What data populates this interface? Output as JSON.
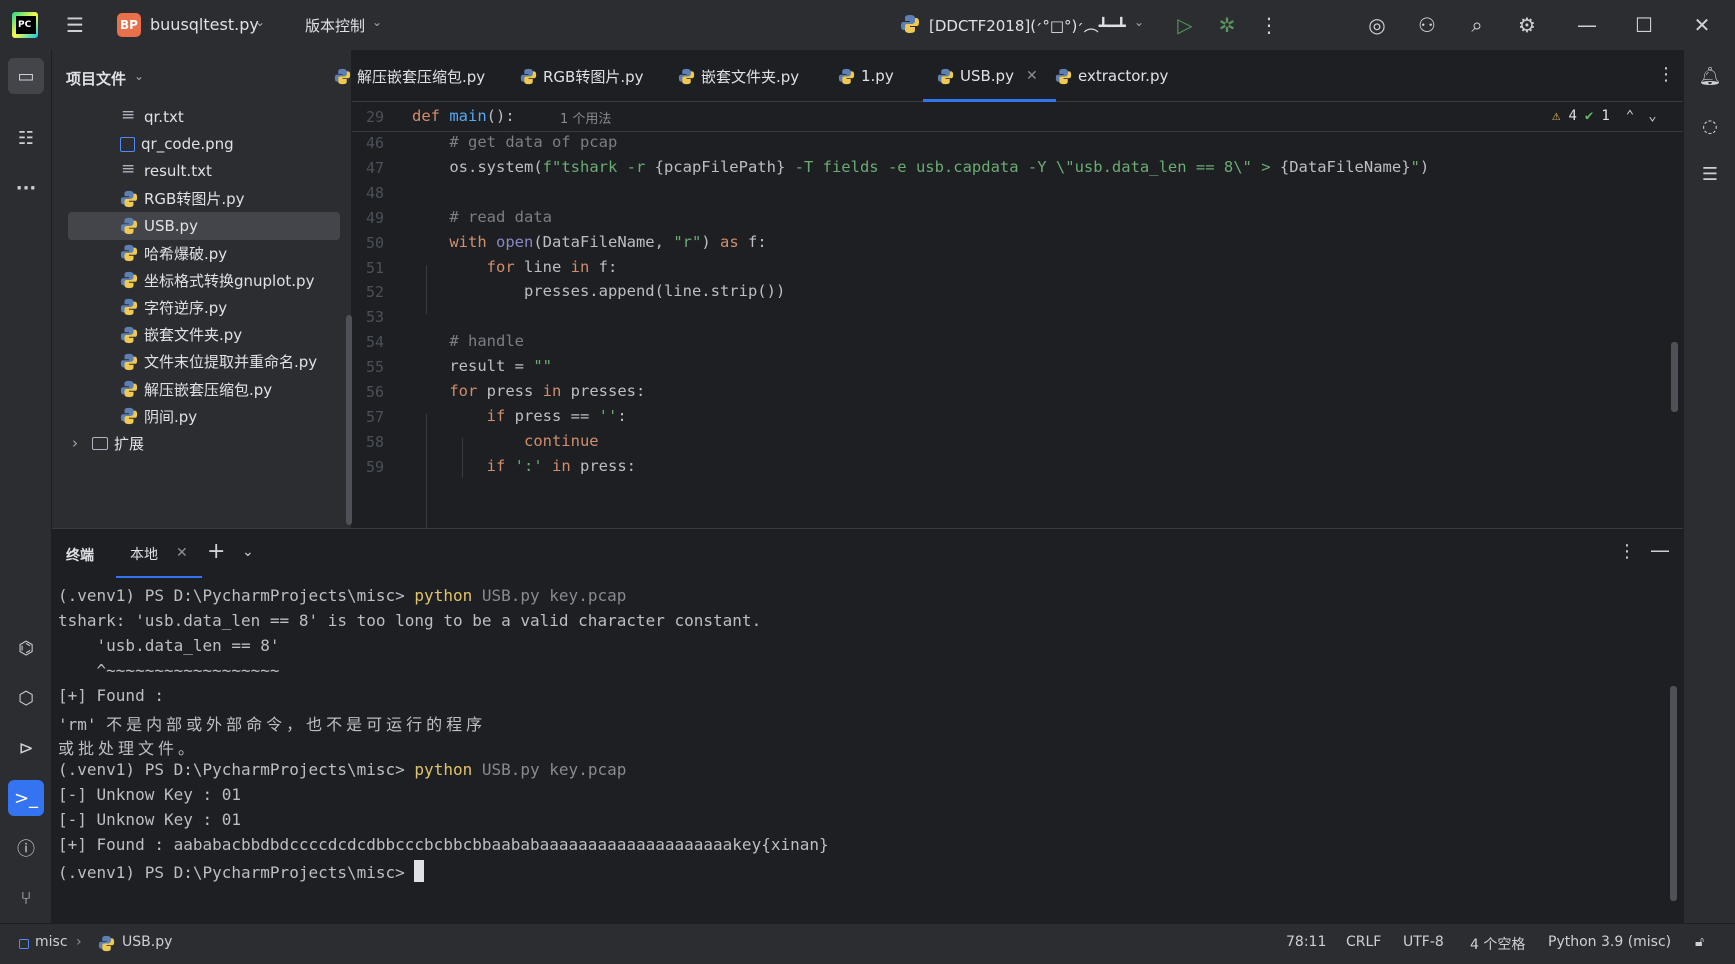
{
  "titlebar": {
    "project_badge": "BP",
    "project_name": "buusqltest.py",
    "vcs_label": "版本控制",
    "run_config": "[DDCTF2018](׳°□°)׳︵┻━┻",
    "icons": [
      "hamburger-icon",
      "run-icon",
      "debug-icon",
      "more-icon",
      "ai-icon",
      "user-icon",
      "search-icon",
      "gear-icon",
      "minimize-icon",
      "maximize-icon",
      "close-icon"
    ]
  },
  "project_panel": {
    "title": "项目文件",
    "items": [
      {
        "label": "qr.txt",
        "type": "txt"
      },
      {
        "label": "qr_code.png",
        "type": "img"
      },
      {
        "label": "result.txt",
        "type": "txt"
      },
      {
        "label": "RGB转图片.py",
        "type": "py"
      },
      {
        "label": "USB.py",
        "type": "py",
        "selected": true
      },
      {
        "label": "哈希爆破.py",
        "type": "py"
      },
      {
        "label": "坐标格式转换gnuplot.py",
        "type": "py"
      },
      {
        "label": "字符逆序.py",
        "type": "py"
      },
      {
        "label": "嵌套文件夹.py",
        "type": "py"
      },
      {
        "label": "文件末位提取并重命名.py",
        "type": "py"
      },
      {
        "label": "解压嵌套压缩包.py",
        "type": "py"
      },
      {
        "label": "阴间.py",
        "type": "py"
      },
      {
        "label": "扩展",
        "type": "folder"
      }
    ]
  },
  "editor_tabs": [
    {
      "label": "解压嵌套压缩包.py"
    },
    {
      "label": "RGB转图片.py"
    },
    {
      "label": "嵌套文件夹.py"
    },
    {
      "label": "1.py"
    },
    {
      "label": "USB.py",
      "active": true
    },
    {
      "label": "extractor.py"
    }
  ],
  "editor": {
    "sticky_line_number": "29",
    "sticky_code_kw": "def",
    "sticky_code_fn": "main",
    "sticky_code_rest": "():",
    "usages": "1 个用法",
    "warnings": "4",
    "checks": "1",
    "lines": [
      {
        "n": "46",
        "html": "    <span class=\"cm\"># get data of pcap</span>"
      },
      {
        "n": "47",
        "html": "    os.system(<span class=\"str\">f\"tshark -r </span>{pcapFilePath}<span class=\"str\"> -T fields -e usb.capdata -Y \\\"usb.data_len == 8\\\" > </span>{DataFileName}<span class=\"str\">\"</span>)"
      },
      {
        "n": "48",
        "html": ""
      },
      {
        "n": "49",
        "html": "    <span class=\"cm\"># read data</span>"
      },
      {
        "n": "50",
        "html": "    <span class=\"kw\">with</span> <span class=\"bi\">open</span>(DataFileName, <span class=\"str\">\"r\"</span>) <span class=\"kw\">as</span> f:"
      },
      {
        "n": "51",
        "html": "        <span class=\"kw\">for</span> line <span class=\"kw\">in</span> f:"
      },
      {
        "n": "52",
        "html": "            presses.append(line.strip())"
      },
      {
        "n": "53",
        "html": ""
      },
      {
        "n": "54",
        "html": "    <span class=\"cm\"># handle</span>"
      },
      {
        "n": "55",
        "html": "    result = <span class=\"str\">\"\"</span>"
      },
      {
        "n": "56",
        "html": "    <span class=\"kw\">for</span> press <span class=\"kw\">in</span> presses:"
      },
      {
        "n": "57",
        "html": "        <span class=\"kw\">if</span> press == <span class=\"str\">''</span>:"
      },
      {
        "n": "58",
        "html": "            <span class=\"kw\">continue</span>"
      },
      {
        "n": "59",
        "html": "        <span class=\"kw\">if</span> <span class=\"str\">':'</span> <span class=\"kw\">in</span> press:"
      }
    ]
  },
  "terminal": {
    "title": "终端",
    "tab_label": "本地",
    "lines": [
      {
        "html": "(.venv1) PS D:\\PycharmProjects\\misc> <span class=\"cmd\">python</span> <span class=\"arg\">USB.py key.pcap</span>"
      },
      {
        "html": "tshark: 'usb.data_len == 8' is too long to be a valid character constant."
      },
      {
        "html": "    'usb.data_len == 8'"
      },
      {
        "html": "    ^~~~~~~~~~~~~~~~~~~"
      },
      {
        "html": "[+] Found :"
      },
      {
        "html": "'rm' <span class=\"cjk\">不是内部或外部命令，也不是可运行的程序</span>"
      },
      {
        "html": "<span class=\"cjk\">或批处理文件。</span>"
      },
      {
        "html": "(.venv1) PS D:\\PycharmProjects\\misc> <span class=\"cmd\">python</span> <span class=\"arg\">USB.py key.pcap</span>"
      },
      {
        "html": "[-] Unknow Key : 01"
      },
      {
        "html": "[-] Unknow Key : 01"
      },
      {
        "html": "[+] Found : aababacbbdbdccccdcdcdbbcccbcbbcbbaababaaaaaaaaaaaaaaaaaaaakey{xinan}"
      },
      {
        "html": "(.venv1) PS D:\\PycharmProjects\\misc> <span id=\"cursor\"></span>"
      }
    ]
  },
  "statusbar": {
    "project": "misc",
    "file": "USB.py",
    "position": "78:11",
    "line_sep": "CRLF",
    "encoding": "UTF-8",
    "indent": "4 个空格",
    "interpreter": "Python 3.9 (misc)"
  },
  "colors": {
    "accent": "#3574f0",
    "background": "#1e1f22",
    "panel": "#2b2d30",
    "keyword": "#cf8e6d",
    "string": "#6aab73",
    "comment": "#7a7e85"
  }
}
